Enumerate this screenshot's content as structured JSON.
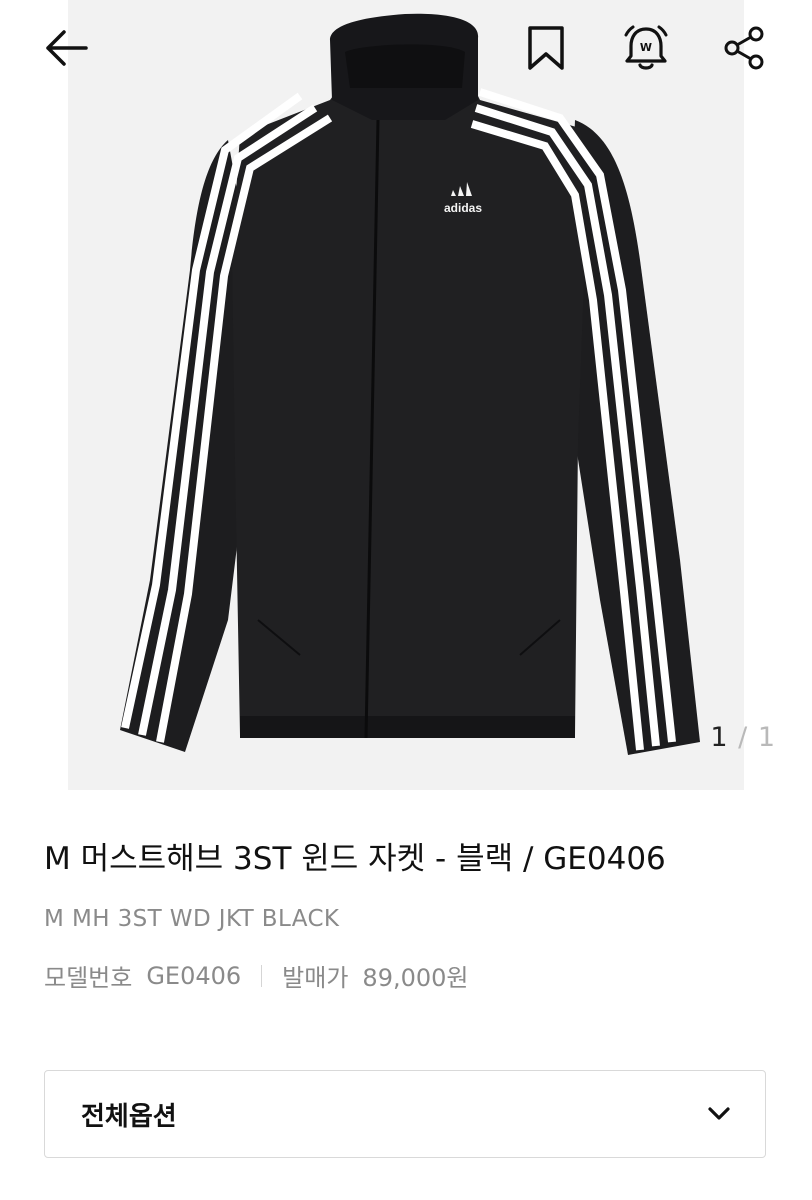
{
  "header": {
    "back_icon": "arrow-left-icon",
    "bookmark_icon": "bookmark-icon",
    "alarm_icon": "w-alarm-bell-icon",
    "share_icon": "share-icon"
  },
  "gallery": {
    "image_desc_icon": "black-windbreaker-jacket-with-three-white-stripes-image",
    "brand_logo_text": "adidas",
    "current_page": "1",
    "separator": "/",
    "total_pages": "1"
  },
  "product": {
    "title": "M 머스트해브 3ST 윈드 자켓 - 블랙 / GE0406",
    "subtitle": "M MH 3ST WD JKT BLACK",
    "model_label": "모델번호",
    "model_value": "GE0406",
    "price_label": "발매가",
    "price_value": "89,000원"
  },
  "options": {
    "label": "전체옵션",
    "chevron_icon": "chevron-down-icon"
  },
  "colors": {
    "accent_text": "#111111",
    "muted_text": "#8a8a8a",
    "hero_bg": "#f2f2f2",
    "border": "#d9d9d9"
  }
}
